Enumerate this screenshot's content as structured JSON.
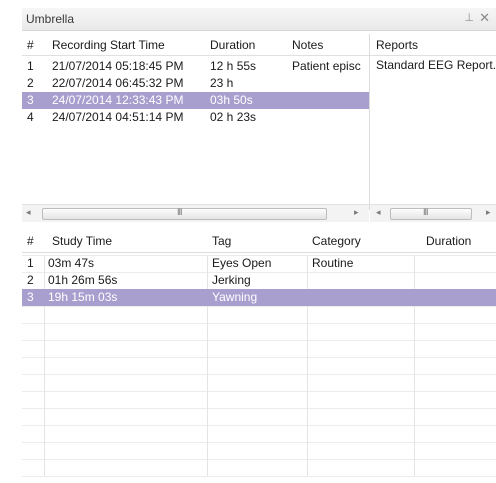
{
  "window": {
    "title": "Umbrella",
    "pin_glyph": "⊥",
    "close_glyph": "✕"
  },
  "recordings": {
    "columns": [
      "#",
      "Recording Start Time",
      "Duration",
      "Notes"
    ],
    "rows": [
      {
        "num": "1",
        "start": "21/07/2014 05:18:45 PM",
        "duration": "12 h  55s",
        "notes": "Patient episc",
        "selected": false
      },
      {
        "num": "2",
        "start": "22/07/2014 06:45:32 PM",
        "duration": "23 h",
        "notes": "",
        "selected": false
      },
      {
        "num": "3",
        "start": "24/07/2014 12:33:43 PM",
        "duration": "03h  50s",
        "notes": "",
        "selected": true
      },
      {
        "num": "4",
        "start": "24/07/2014 04:51:14 PM",
        "duration": "02 h  23s",
        "notes": "",
        "selected": false
      }
    ]
  },
  "reports": {
    "column": "Reports",
    "rows": [
      "Standard EEG Report."
    ]
  },
  "studies": {
    "columns": [
      "#",
      "Study Time",
      "Tag",
      "Category",
      "Duration"
    ],
    "rows": [
      {
        "num": "1",
        "time": "03m 47s",
        "tag": "Eyes Open",
        "category": "Routine",
        "duration": "",
        "selected": false
      },
      {
        "num": "2",
        "time": "01h 26m 56s",
        "tag": "Jerking",
        "category": "",
        "duration": "",
        "selected": false
      },
      {
        "num": "3",
        "time": "19h 15m 03s",
        "tag": "Yawning",
        "category": "",
        "duration": "",
        "selected": true
      }
    ]
  },
  "scrollbar": {
    "left_arrow": "◂",
    "right_arrow": "▸",
    "grip": "III"
  }
}
